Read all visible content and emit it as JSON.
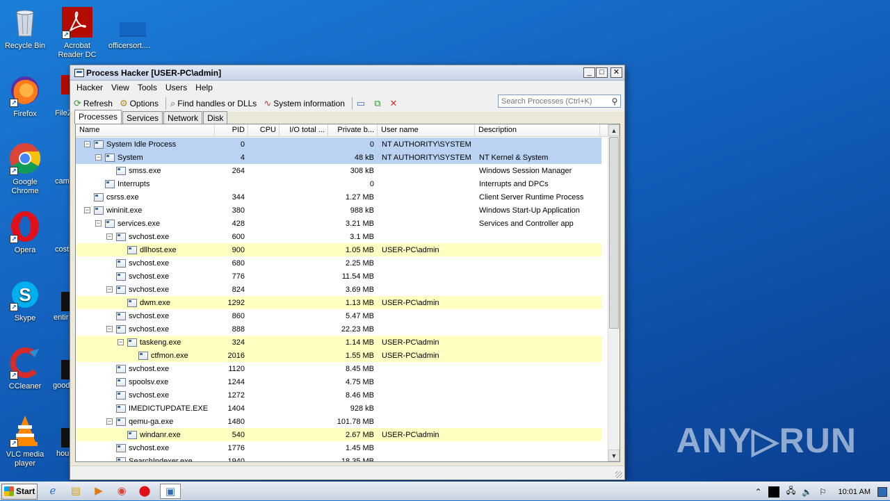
{
  "desktop": {
    "icons": [
      {
        "label": "Recycle Bin"
      },
      {
        "label": "Acrobat Reader DC"
      },
      {
        "label": "officersort...."
      },
      {
        "label": "Firefox"
      },
      {
        "label": "Google Chrome"
      },
      {
        "label": "Opera"
      },
      {
        "label": "Skype"
      },
      {
        "label": "CCleaner"
      },
      {
        "label": "VLC media player"
      }
    ],
    "partial_labels": [
      "FileZ",
      "came",
      "cost",
      "entir",
      "good",
      "hou"
    ]
  },
  "window": {
    "title": "Process Hacker [USER-PC\\admin]",
    "menu": [
      "Hacker",
      "View",
      "Tools",
      "Users",
      "Help"
    ],
    "toolbar": {
      "refresh": "Refresh",
      "options": "Options",
      "find_handles": "Find handles or DLLs",
      "system_info": "System information"
    },
    "search_placeholder": "Search Processes (Ctrl+K)",
    "tabs": [
      "Processes",
      "Services",
      "Network",
      "Disk"
    ],
    "columns": [
      "Name",
      "PID",
      "CPU",
      "I/O total ...",
      "Private b...",
      "User name",
      "Description"
    ],
    "processes": [
      {
        "name": "System Idle Process",
        "pid": "0",
        "priv": "0",
        "user": "NT AUTHORITY\\SYSTEM",
        "desc": "",
        "depth": 0,
        "toggle": "−",
        "hl": "sys"
      },
      {
        "name": "System",
        "pid": "4",
        "priv": "48 kB",
        "user": "NT AUTHORITY\\SYSTEM",
        "desc": "NT Kernel & System",
        "depth": 1,
        "toggle": "−",
        "hl": "sys"
      },
      {
        "name": "smss.exe",
        "pid": "264",
        "priv": "308 kB",
        "user": "",
        "desc": "Windows Session Manager",
        "depth": 2,
        "toggle": "",
        "hl": ""
      },
      {
        "name": "Interrupts",
        "pid": "",
        "priv": "0",
        "user": "",
        "desc": "Interrupts and DPCs",
        "depth": 1,
        "toggle": "",
        "hl": ""
      },
      {
        "name": "csrss.exe",
        "pid": "344",
        "priv": "1.27 MB",
        "user": "",
        "desc": "Client Server Runtime Process",
        "depth": 0,
        "toggle": "",
        "hl": ""
      },
      {
        "name": "wininit.exe",
        "pid": "380",
        "priv": "988 kB",
        "user": "",
        "desc": "Windows Start-Up Application",
        "depth": 0,
        "toggle": "−",
        "hl": ""
      },
      {
        "name": "services.exe",
        "pid": "428",
        "priv": "3.21 MB",
        "user": "",
        "desc": "Services and Controller app",
        "depth": 1,
        "toggle": "−",
        "hl": ""
      },
      {
        "name": "svchost.exe",
        "pid": "600",
        "priv": "3.1 MB",
        "user": "",
        "desc": "",
        "depth": 2,
        "toggle": "−",
        "hl": ""
      },
      {
        "name": "dllhost.exe",
        "pid": "900",
        "priv": "1.05 MB",
        "user": "USER-PC\\admin",
        "desc": "",
        "depth": 3,
        "toggle": "",
        "hl": "usr"
      },
      {
        "name": "svchost.exe",
        "pid": "680",
        "priv": "2.25 MB",
        "user": "",
        "desc": "",
        "depth": 2,
        "toggle": "",
        "hl": ""
      },
      {
        "name": "svchost.exe",
        "pid": "776",
        "priv": "11.54 MB",
        "user": "",
        "desc": "",
        "depth": 2,
        "toggle": "",
        "hl": ""
      },
      {
        "name": "svchost.exe",
        "pid": "824",
        "priv": "3.69 MB",
        "user": "",
        "desc": "",
        "depth": 2,
        "toggle": "−",
        "hl": ""
      },
      {
        "name": "dwm.exe",
        "pid": "1292",
        "priv": "1.13 MB",
        "user": "USER-PC\\admin",
        "desc": "",
        "depth": 3,
        "toggle": "",
        "hl": "usr"
      },
      {
        "name": "svchost.exe",
        "pid": "860",
        "priv": "5.47 MB",
        "user": "",
        "desc": "",
        "depth": 2,
        "toggle": "",
        "hl": ""
      },
      {
        "name": "svchost.exe",
        "pid": "888",
        "priv": "22.23 MB",
        "user": "",
        "desc": "",
        "depth": 2,
        "toggle": "−",
        "hl": ""
      },
      {
        "name": "taskeng.exe",
        "pid": "324",
        "priv": "1.14 MB",
        "user": "USER-PC\\admin",
        "desc": "",
        "depth": 3,
        "toggle": "−",
        "hl": "usr"
      },
      {
        "name": "ctfmon.exe",
        "pid": "2016",
        "priv": "1.55 MB",
        "user": "USER-PC\\admin",
        "desc": "",
        "depth": 4,
        "toggle": "",
        "hl": "usr"
      },
      {
        "name": "svchost.exe",
        "pid": "1120",
        "priv": "8.45 MB",
        "user": "",
        "desc": "",
        "depth": 2,
        "toggle": "",
        "hl": ""
      },
      {
        "name": "spoolsv.exe",
        "pid": "1244",
        "priv": "4.75 MB",
        "user": "",
        "desc": "",
        "depth": 2,
        "toggle": "",
        "hl": ""
      },
      {
        "name": "svchost.exe",
        "pid": "1272",
        "priv": "8.46 MB",
        "user": "",
        "desc": "",
        "depth": 2,
        "toggle": "",
        "hl": ""
      },
      {
        "name": "IMEDICTUPDATE.EXE",
        "pid": "1404",
        "priv": "928 kB",
        "user": "",
        "desc": "",
        "depth": 2,
        "toggle": "",
        "hl": ""
      },
      {
        "name": "qemu-ga.exe",
        "pid": "1480",
        "priv": "101.78 MB",
        "user": "",
        "desc": "",
        "depth": 2,
        "toggle": "−",
        "hl": ""
      },
      {
        "name": "windanr.exe",
        "pid": "540",
        "priv": "2.67 MB",
        "user": "USER-PC\\admin",
        "desc": "",
        "depth": 3,
        "toggle": "",
        "hl": "usr"
      },
      {
        "name": "svchost.exe",
        "pid": "1776",
        "priv": "1.45 MB",
        "user": "",
        "desc": "",
        "depth": 2,
        "toggle": "",
        "hl": ""
      },
      {
        "name": "SearchIndexer.exe",
        "pid": "1940",
        "priv": "18.35 MB",
        "user": "",
        "desc": "",
        "depth": 2,
        "toggle": "",
        "hl": ""
      }
    ]
  },
  "taskbar": {
    "start_label": "Start",
    "clock": "10:01 AM"
  },
  "watermark": "ANY▷RUN",
  "colors": {
    "system_row": "#bad3f3",
    "user_row": "#ffffc2",
    "desktop_bg": "#1566c2"
  }
}
